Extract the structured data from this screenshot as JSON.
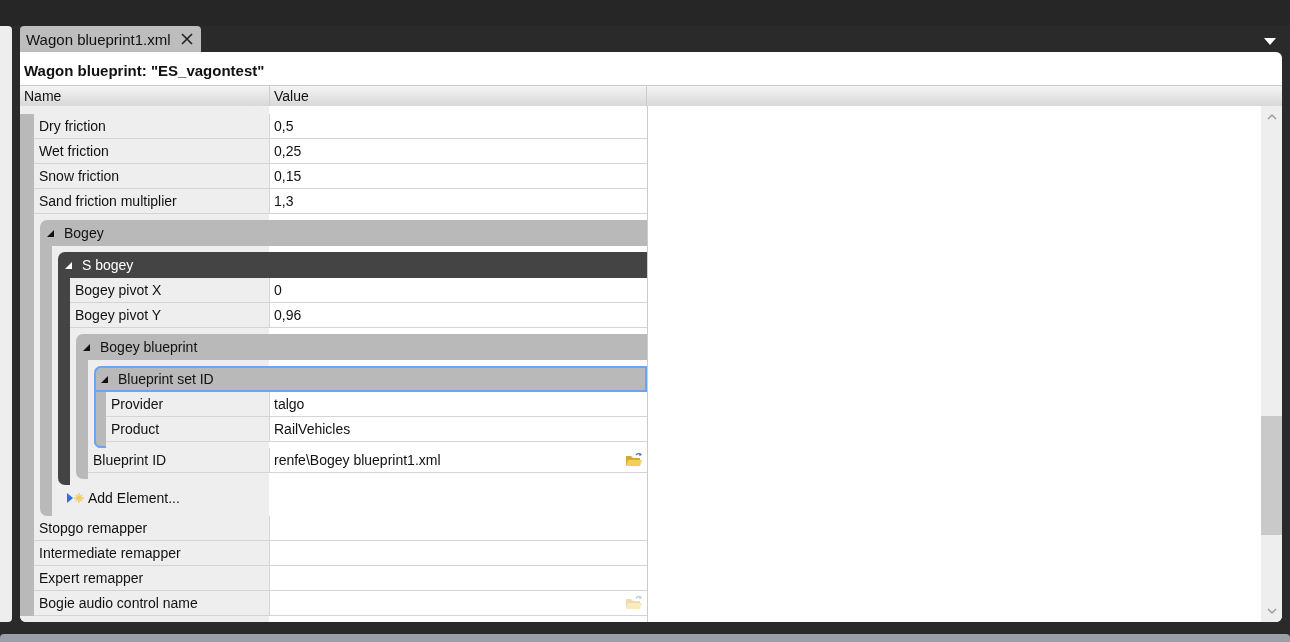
{
  "tabs": [
    {
      "label": "Wagon blueprint1.xml",
      "selected": true
    }
  ],
  "document": {
    "title": "Wagon blueprint: \"ES_vagontest\"",
    "columns": [
      "Name",
      "Value"
    ],
    "rows": [
      {
        "kind": "row",
        "name": "Dry friction",
        "value": "0,5",
        "browse": false
      },
      {
        "kind": "row",
        "name": "Wet friction",
        "value": "0,25",
        "browse": false
      },
      {
        "kind": "row",
        "name": "Snow friction",
        "value": "0,15",
        "browse": false
      },
      {
        "kind": "row",
        "name": "Sand friction multiplier",
        "value": "1,3",
        "browse": false
      },
      {
        "kind": "group",
        "name": "Bogey",
        "expanded": true,
        "selected": false,
        "color": "#b9b9b9",
        "children": [
          {
            "kind": "group",
            "name": "S bogey",
            "expanded": true,
            "selected": false,
            "color": "#444444",
            "children": [
              {
                "kind": "row",
                "name": "Bogey pivot X",
                "value": "0",
                "browse": false
              },
              {
                "kind": "row",
                "name": "Bogey pivot Y",
                "value": "0,96",
                "browse": false
              },
              {
                "kind": "group",
                "name": "Bogey blueprint",
                "expanded": true,
                "selected": false,
                "color": "#b9b9b9",
                "children": [
                  {
                    "kind": "group",
                    "name": "Blueprint set ID",
                    "expanded": true,
                    "selected": true,
                    "color": "#b9b9b9",
                    "children": [
                      {
                        "kind": "row",
                        "name": "Provider",
                        "value": "talgo",
                        "browse": false
                      },
                      {
                        "kind": "row",
                        "name": "Product",
                        "value": "RailVehicles",
                        "browse": false
                      }
                    ]
                  },
                  {
                    "kind": "row",
                    "name": "Blueprint ID",
                    "value": "renfe\\Bogey blueprint1.xml",
                    "browse": true
                  }
                ]
              }
            ]
          },
          {
            "kind": "add",
            "name": "Add Element..."
          }
        ]
      },
      {
        "kind": "row",
        "name": "Stopgo remapper",
        "value": "",
        "browse": false
      },
      {
        "kind": "row",
        "name": "Intermediate remapper",
        "value": "",
        "browse": false
      },
      {
        "kind": "row",
        "name": "Expert remapper",
        "value": "",
        "browse": false
      },
      {
        "kind": "row",
        "name": "Bogie audio control name",
        "value": "",
        "browse": true
      }
    ]
  }
}
